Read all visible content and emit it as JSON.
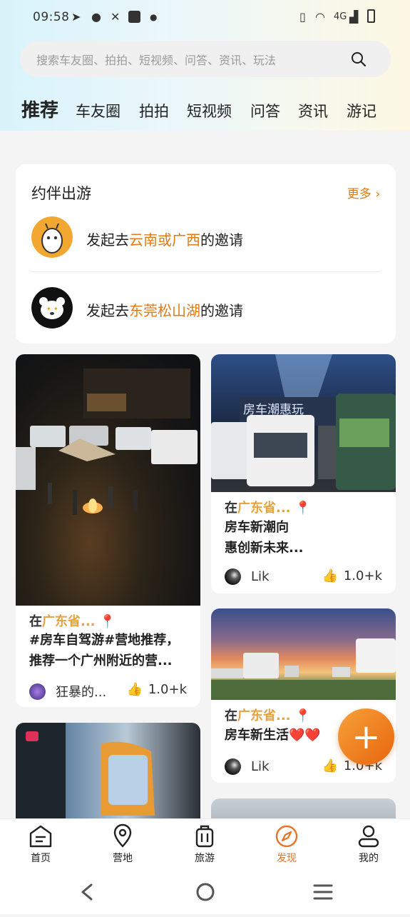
{
  "status": {
    "time": "09:58",
    "network": "4G"
  },
  "search": {
    "placeholder": "搜索车友圈、拍拍、短视频、问答、资讯、玩法"
  },
  "tabs": [
    "推荐",
    "车友圈",
    "拍拍",
    "短视频",
    "问答",
    "资讯",
    "游记"
  ],
  "companion": {
    "title": "约伴出游",
    "more": "更多",
    "invites": [
      {
        "prefix": "发起去",
        "place": "云南或广西",
        "suffix": "的邀请"
      },
      {
        "prefix": "发起去",
        "place": "东莞松山湖",
        "suffix": "的邀请"
      }
    ]
  },
  "posts": [
    {
      "loc_prefix": "在",
      "loc": "广东省...",
      "title1": "#房车自驾游#营地推荐，",
      "title2": "推荐一个广州附近的营...",
      "user": "狂暴的...",
      "likes": "1.0+k"
    },
    {
      "loc_prefix": "在",
      "loc": "广东省...",
      "title1": "房车新潮向",
      "title2": "惠创新未来...",
      "user": "Lik",
      "likes": "1.0+k"
    },
    {
      "loc_prefix": "在",
      "loc": "广东省...",
      "title1": "房车新生活❤️❤️",
      "title2": "",
      "user": "Lik",
      "likes": "1.0+k"
    }
  ],
  "images": {
    "sign1": "房车潮惠玩"
  },
  "bottom_nav": [
    {
      "label": "首页",
      "icon": "home-icon"
    },
    {
      "label": "营地",
      "icon": "location-icon"
    },
    {
      "label": "旅游",
      "icon": "luggage-icon"
    },
    {
      "label": "发现",
      "icon": "compass-icon",
      "active": true
    },
    {
      "label": "我的",
      "icon": "user-icon"
    }
  ],
  "colors": {
    "accent": "#e8742b",
    "highlight": "#e07a17"
  }
}
